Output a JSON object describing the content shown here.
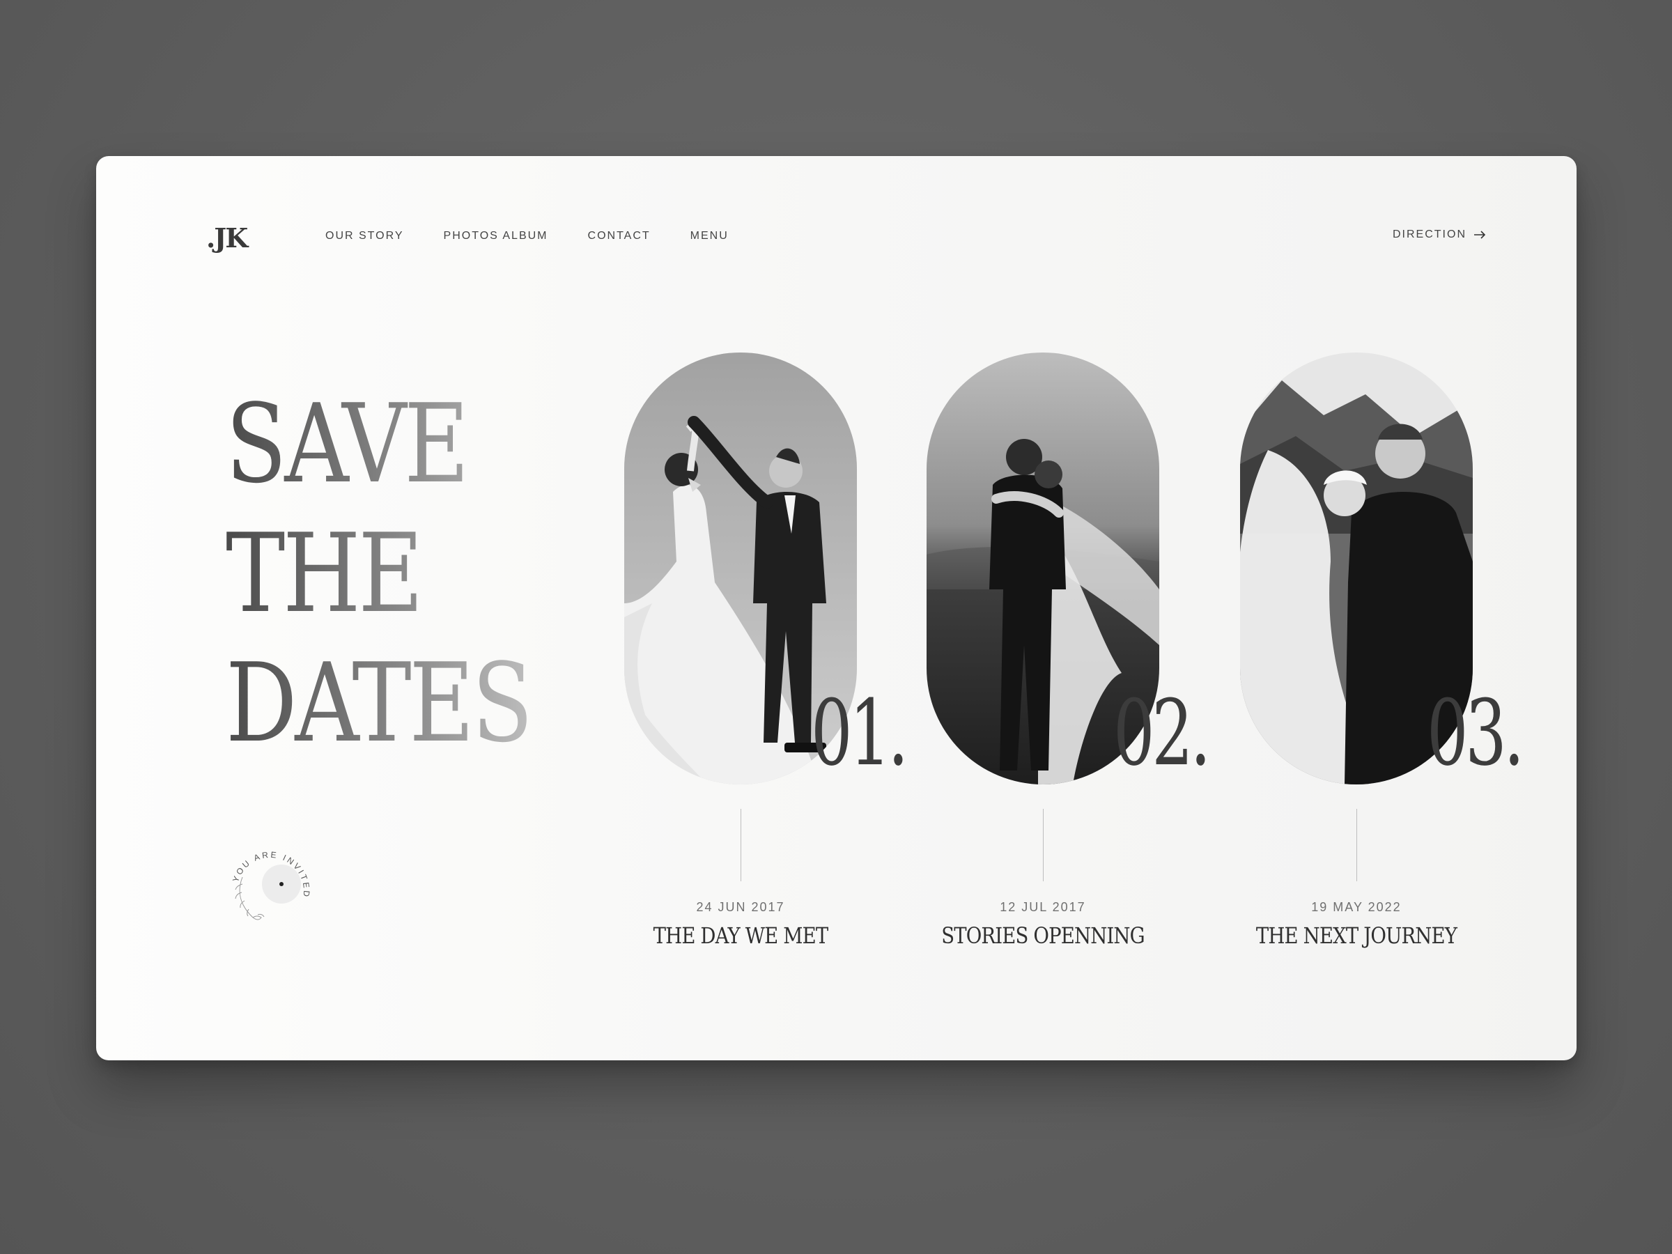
{
  "brand": {
    "logo": ".JK"
  },
  "nav": {
    "items": [
      {
        "label": "OUR STORY"
      },
      {
        "label": "PHOTOS ALBUM"
      },
      {
        "label": "CONTACT"
      },
      {
        "label": "MENU"
      }
    ],
    "direction": {
      "label": "DIRECTION",
      "icon": "arrow-right-icon"
    }
  },
  "hero": {
    "line1": "SAVE",
    "line2": "THE",
    "line3": "DATES"
  },
  "seal": {
    "text": "YOU ARE INVITED"
  },
  "moments": [
    {
      "number": "01.",
      "date": "24 JUN 2017",
      "title": "THE DAY WE MET"
    },
    {
      "number": "02.",
      "date": "12 JUL 2017",
      "title": "STORIES OPENNING"
    },
    {
      "number": "03.",
      "date": "19 MAY 2022",
      "title": "THE NEXT JOURNEY"
    }
  ],
  "colors": {
    "page_bg": "#5f5f5f",
    "card_bg": "#f7f7f6",
    "text": "#2f2f2f",
    "muted": "#6f6f6f"
  }
}
